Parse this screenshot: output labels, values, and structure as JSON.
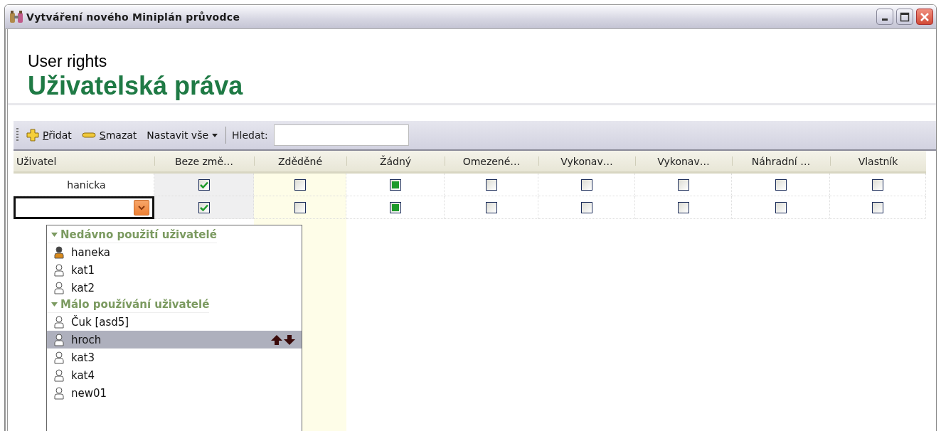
{
  "window": {
    "title": "Vytváření nového Miniplán průvodce"
  },
  "header": {
    "subtitle": "User rights",
    "title": "Uživatelská práva"
  },
  "toolbar": {
    "add": "Přidat",
    "delete": "Smazat",
    "set_all": "Nastavit vše",
    "search_label": "Hledat:"
  },
  "table": {
    "columns": [
      {
        "label": "Uživatel",
        "kind": "user"
      },
      {
        "label": "Beze změ…",
        "kind": "check"
      },
      {
        "label": "Zděděné",
        "kind": "check"
      },
      {
        "label": "Žádný",
        "kind": "radio"
      },
      {
        "label": "Omezené…",
        "kind": "check"
      },
      {
        "label": "Vykonav…",
        "kind": "check"
      },
      {
        "label": "Vykonav…",
        "kind": "check"
      },
      {
        "label": "Náhradní …",
        "kind": "check"
      },
      {
        "label": "Vlastník",
        "kind": "check"
      }
    ],
    "rows": [
      {
        "kind": "text",
        "user": "hanicka",
        "cells": [
          true,
          false,
          true,
          false,
          false,
          false,
          false,
          false
        ]
      },
      {
        "kind": "combo",
        "cells": [
          true,
          false,
          true,
          false,
          false,
          false,
          false,
          false
        ]
      }
    ]
  },
  "dropdown": {
    "groups": [
      {
        "title": "Nedávno použití uživatelé",
        "users": [
          {
            "name": "haneka",
            "highlighted": true,
            "selected": false
          },
          {
            "name": "kat1",
            "highlighted": false,
            "selected": false
          },
          {
            "name": "kat2",
            "highlighted": false,
            "selected": false
          }
        ]
      },
      {
        "title": "Málo používání uživatelé",
        "users": [
          {
            "name": "Čuk [asd5]",
            "highlighted": false,
            "selected": false
          },
          {
            "name": "hroch",
            "highlighted": false,
            "selected": true
          },
          {
            "name": "kat3",
            "highlighted": false,
            "selected": false
          },
          {
            "name": "kat4",
            "highlighted": false,
            "selected": false
          },
          {
            "name": "new01",
            "highlighted": false,
            "selected": false
          }
        ]
      }
    ]
  }
}
